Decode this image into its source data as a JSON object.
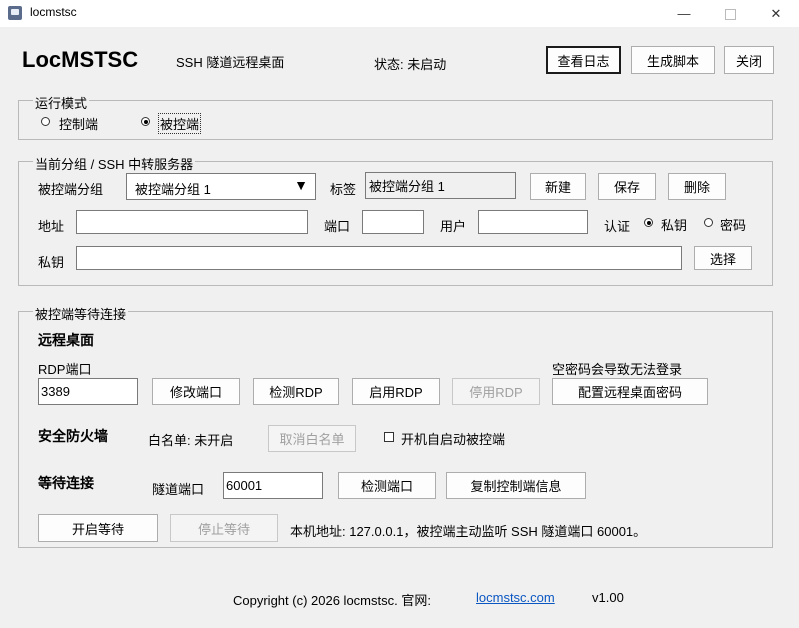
{
  "window": {
    "title": "locmstsc",
    "minimize": "—",
    "close": "✕"
  },
  "header": {
    "app_name": "LocMSTSC",
    "subtitle": "SSH 隧道远程桌面",
    "status": "状态: 未启动",
    "view_log": "查看日志",
    "gen_script": "生成脚本",
    "close": "关闭"
  },
  "mode": {
    "legend": "运行模式",
    "options": [
      {
        "label": "控制端",
        "selected": false
      },
      {
        "label": "被控端",
        "selected": true
      }
    ]
  },
  "server": {
    "legend": "当前分组 / SSH 中转服务器",
    "group_label": "被控端分组",
    "group_value": "被控端分组 1",
    "tag_label": "标签",
    "tag_value": "被控端分组 1",
    "new": "新建",
    "save": "保存",
    "delete": "删除",
    "address_label": "地址",
    "address_value": "",
    "port_label": "端口",
    "port_value": "",
    "user_label": "用户",
    "user_value": "",
    "auth_label": "认证",
    "auth_key": "私钥",
    "auth_password": "密码",
    "key_label": "私钥",
    "key_value": "",
    "choose": "选择"
  },
  "waiting": {
    "legend": "被控端等待连接",
    "rd_heading": "远程桌面",
    "rdp_port_label": "RDP端口",
    "rdp_port_value": "3389",
    "empty_pw_warning": "空密码会导致无法登录",
    "modify_port": "修改端口",
    "check_rdp": "检测RDP",
    "enable_rdp": "启用RDP",
    "disable_rdp": "停用RDP",
    "config_password": "配置远程桌面密码",
    "firewall_heading": "安全防火墙",
    "whitelist_status": "白名单: 未开启",
    "cancel_whitelist": "取消白名单",
    "autostart_label": "开机自启动被控端",
    "wait_heading": "等待连接",
    "tunnel_port_label": "隧道端口",
    "tunnel_port_value": "60001",
    "check_port": "检测端口",
    "copy_info": "复制控制端信息",
    "start_wait": "开启等待",
    "stop_wait": "停止等待",
    "local_address": "本机地址: 127.0.0.1，被控端主动监听 SSH 隧道端口 60001。"
  },
  "footer": {
    "copyright": "Copyright (c) 2026 locmstsc. 官网:",
    "website": "locmstsc.com",
    "version": "v1.00"
  },
  "colors": {
    "link": "#0b57c2",
    "background": "#f0f0f0"
  }
}
